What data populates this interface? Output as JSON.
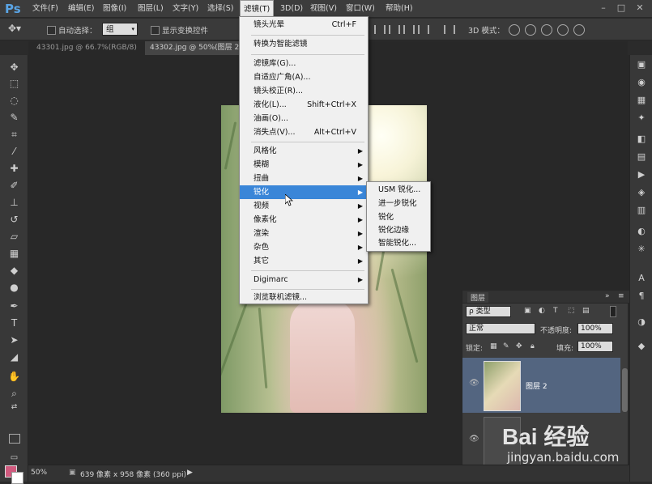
{
  "menubar": {
    "logo": "Ps",
    "items": [
      "文件(F)",
      "编辑(E)",
      "图像(I)",
      "图层(L)",
      "文字(Y)",
      "选择(S)",
      "滤镜(T)",
      "3D(D)",
      "视图(V)",
      "窗口(W)",
      "帮助(H)"
    ],
    "active_index": 6
  },
  "options": {
    "auto_select": "自动选择：",
    "group": "组",
    "show_transform": "显示变换控件",
    "mode3d": "3D 模式："
  },
  "tabs": [
    {
      "label": "43301.jpg @ 66.7%(RGB/8)",
      "close": "×"
    },
    {
      "label": "43302.jpg @ 50%(图层 2",
      "close": ""
    }
  ],
  "filter_menu": {
    "items": [
      {
        "label": "镜头光晕",
        "shortcut": "Ctrl+F"
      },
      {
        "label": "转换为智能滤镜"
      },
      {
        "label": "滤镜库(G)..."
      },
      {
        "label": "自适应广角(A)..."
      },
      {
        "label": "镜头校正(R)..."
      },
      {
        "label": "液化(L)...",
        "shortcut": "Shift+Ctrl+X"
      },
      {
        "label": "油画(O)..."
      },
      {
        "label": "消失点(V)...",
        "shortcut": "Alt+Ctrl+V"
      },
      {
        "label": "风格化",
        "arrow": "▶"
      },
      {
        "label": "模糊",
        "arrow": "▶"
      },
      {
        "label": "扭曲",
        "arrow": "▶"
      },
      {
        "label": "锐化",
        "arrow": "▶"
      },
      {
        "label": "视频",
        "arrow": "▶"
      },
      {
        "label": "像素化",
        "arrow": "▶"
      },
      {
        "label": "渲染",
        "arrow": "▶"
      },
      {
        "label": "杂色",
        "arrow": "▶"
      },
      {
        "label": "其它",
        "arrow": "▶"
      },
      {
        "label": "Digimarc",
        "arrow": "▶"
      },
      {
        "label": "浏览联机滤镜..."
      }
    ],
    "highlight_index": 11
  },
  "sharpen_submenu": [
    "USM 锐化...",
    "进一步锐化",
    "锐化",
    "锐化边缘",
    "智能锐化..."
  ],
  "layers_panel": {
    "title": "图层",
    "kind": "ρ 类型",
    "blend": "正常",
    "opacity_label": "不透明度:",
    "opacity": "100%",
    "lock_label": "锁定:",
    "fill_label": "填充:",
    "fill": "100%",
    "layer_name": "图层 2"
  },
  "status": {
    "zoom": "50%",
    "info": "639 像素 x 958 像素 (360 ppi)"
  },
  "watermark": {
    "text": "Bai 经验",
    "url": "jingyan.baidu.com"
  },
  "colors": {
    "menu_highlight": "#3a86d8",
    "foreground": "#d05a7e",
    "background": "#ffffff",
    "layer_selected": "#536580"
  }
}
